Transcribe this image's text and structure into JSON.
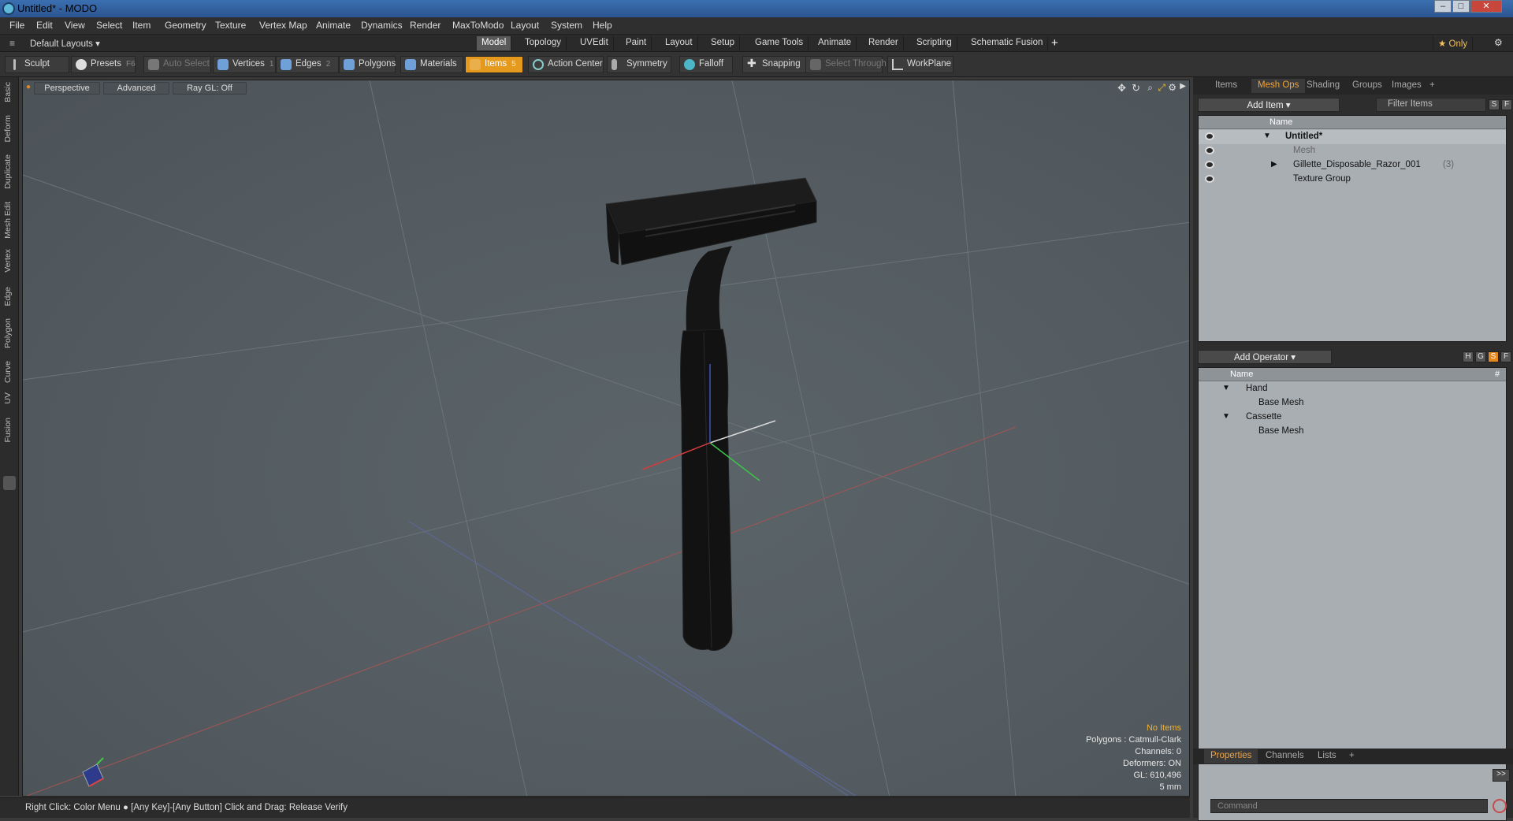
{
  "window": {
    "title": "Untitled* - MODO",
    "min": "–",
    "max": "□",
    "close": "✕"
  },
  "menu": [
    "File",
    "Edit",
    "View",
    "Select",
    "Item",
    "Geometry",
    "Texture",
    "Vertex Map",
    "Animate",
    "Dynamics",
    "Render",
    "MaxToModo",
    "Layout",
    "System",
    "Help"
  ],
  "layoutbar": {
    "preset": "Default Layouts ▾",
    "tabs": [
      "Model",
      "Topology",
      "UVEdit",
      "Paint",
      "Layout",
      "Setup",
      "Game Tools",
      "Animate",
      "Render",
      "Scripting",
      "Schematic Fusion"
    ],
    "active_tab": "Model",
    "add": "+",
    "only": "★ Only",
    "gear": "⚙"
  },
  "toolbar": {
    "sculpt": "Sculpt",
    "presets": "Presets",
    "presets_key": "F6",
    "auto_select": "Auto Select",
    "vertices": "Vertices",
    "vertices_key": "1",
    "edges": "Edges",
    "edges_key": "2",
    "polygons": "Polygons",
    "materials": "Materials",
    "items": "Items",
    "items_key": "5",
    "action_center": "Action Center",
    "symmetry": "Symmetry",
    "falloff": "Falloff",
    "snapping": "Snapping",
    "select_through": "Select Through",
    "workplane": "WorkPlane"
  },
  "left_tabs": [
    "Basic",
    "Deform",
    "Duplicate",
    "Mesh Edit",
    "Vertex",
    "Edge",
    "Polygon",
    "Curve",
    "UV",
    "Fusion"
  ],
  "viewport": {
    "perspective": "Perspective",
    "advanced": "Advanced",
    "raygl": "Ray GL: Off",
    "stats": {
      "selection": "No Items",
      "polygons": "Polygons : Catmull-Clark",
      "channels": "Channels: 0",
      "deformers": "Deformers: ON",
      "gl": "GL: 610,496",
      "scale": "5 mm"
    }
  },
  "statusbar": {
    "text": "Right Click: Color Menu ● [Any Key]-[Any Button] Click and Drag: Release Verify"
  },
  "right_panel": {
    "top_tabs": [
      "Items",
      "Mesh Ops",
      "Shading",
      "Groups",
      "Images",
      "+"
    ],
    "top_active": "Mesh Ops",
    "add_item": "Add Item",
    "filter_items": "Filter Items",
    "s": "S",
    "f": "F",
    "name_col": "Name",
    "items": [
      {
        "label": "Untitled*",
        "bold": true
      },
      {
        "label": "Mesh",
        "dim": true
      },
      {
        "label": "Gillette_Disposable_Razor_001",
        "count": "(3)"
      },
      {
        "label": "Texture Group"
      }
    ],
    "add_operator": "Add Operator",
    "op_name_col": "Name",
    "op_hash_col": "#",
    "h": "H",
    "g": "G",
    "operators": [
      {
        "label": "Hand",
        "expand": "▼"
      },
      {
        "label": "Base Mesh",
        "child": true
      },
      {
        "label": "Cassette",
        "expand": "▼"
      },
      {
        "label": "Base Mesh",
        "child": true
      }
    ],
    "bottom_tabs": [
      "Properties",
      "Channels",
      "Lists",
      "+"
    ],
    "bottom_active": "Properties",
    "expand_btn": ">>",
    "command_placeholder": "Command"
  },
  "colors": {
    "accent": "#e59a1d",
    "tab_active": "#f3a33a",
    "viewport": "#566065",
    "tree_bg": "#a9aeb3"
  }
}
